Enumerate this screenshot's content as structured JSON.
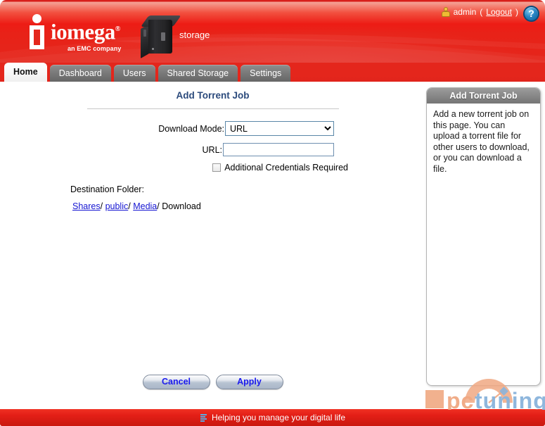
{
  "header": {
    "logo_word": "iomega",
    "logo_reg": "®",
    "logo_tagline": "an EMC company",
    "device_label": "storage",
    "user_name": "admin",
    "logout_open": "(",
    "logout_label": "Logout",
    "logout_close": ")",
    "help_glyph": "?"
  },
  "tabs": [
    {
      "label": "Home",
      "active": true
    },
    {
      "label": "Dashboard",
      "active": false
    },
    {
      "label": "Users",
      "active": false
    },
    {
      "label": "Shared Storage",
      "active": false
    },
    {
      "label": "Settings",
      "active": false
    }
  ],
  "main": {
    "page_title": "Add Torrent Job",
    "download_mode_label": "Download Mode:",
    "download_mode_value": "URL",
    "download_mode_options": [
      "URL"
    ],
    "url_label": "URL:",
    "url_value": "",
    "url_placeholder": "",
    "credentials_label": "Additional Credentials Required",
    "credentials_checked": false,
    "destination_label": "Destination Folder:",
    "destination_path": [
      {
        "label": "Shares",
        "link": true
      },
      {
        "label": "/",
        "link": false
      },
      {
        "label": "public",
        "link": true
      },
      {
        "label": "/",
        "link": false
      },
      {
        "label": "Media",
        "link": true
      },
      {
        "label": "/",
        "link": false
      },
      {
        "label": "Download",
        "link": false
      }
    ],
    "cancel_label": "Cancel",
    "apply_label": "Apply"
  },
  "sidebar": {
    "title": "Add Torrent Job",
    "body": "Add a new torrent job on this page. You can upload a torrent file for other users to download, or you can download a file."
  },
  "watermark": {
    "text_pc": "pc",
    "text_tuning": "tuning"
  },
  "footer": {
    "tagline": "Helping you manage your digital life"
  },
  "colors": {
    "brand_red": "#e4261c",
    "tab_gray": "#7b7b7b",
    "title_blue": "#2b4a7c",
    "link_blue": "#1414d2",
    "button_text": "#1a1aee"
  }
}
